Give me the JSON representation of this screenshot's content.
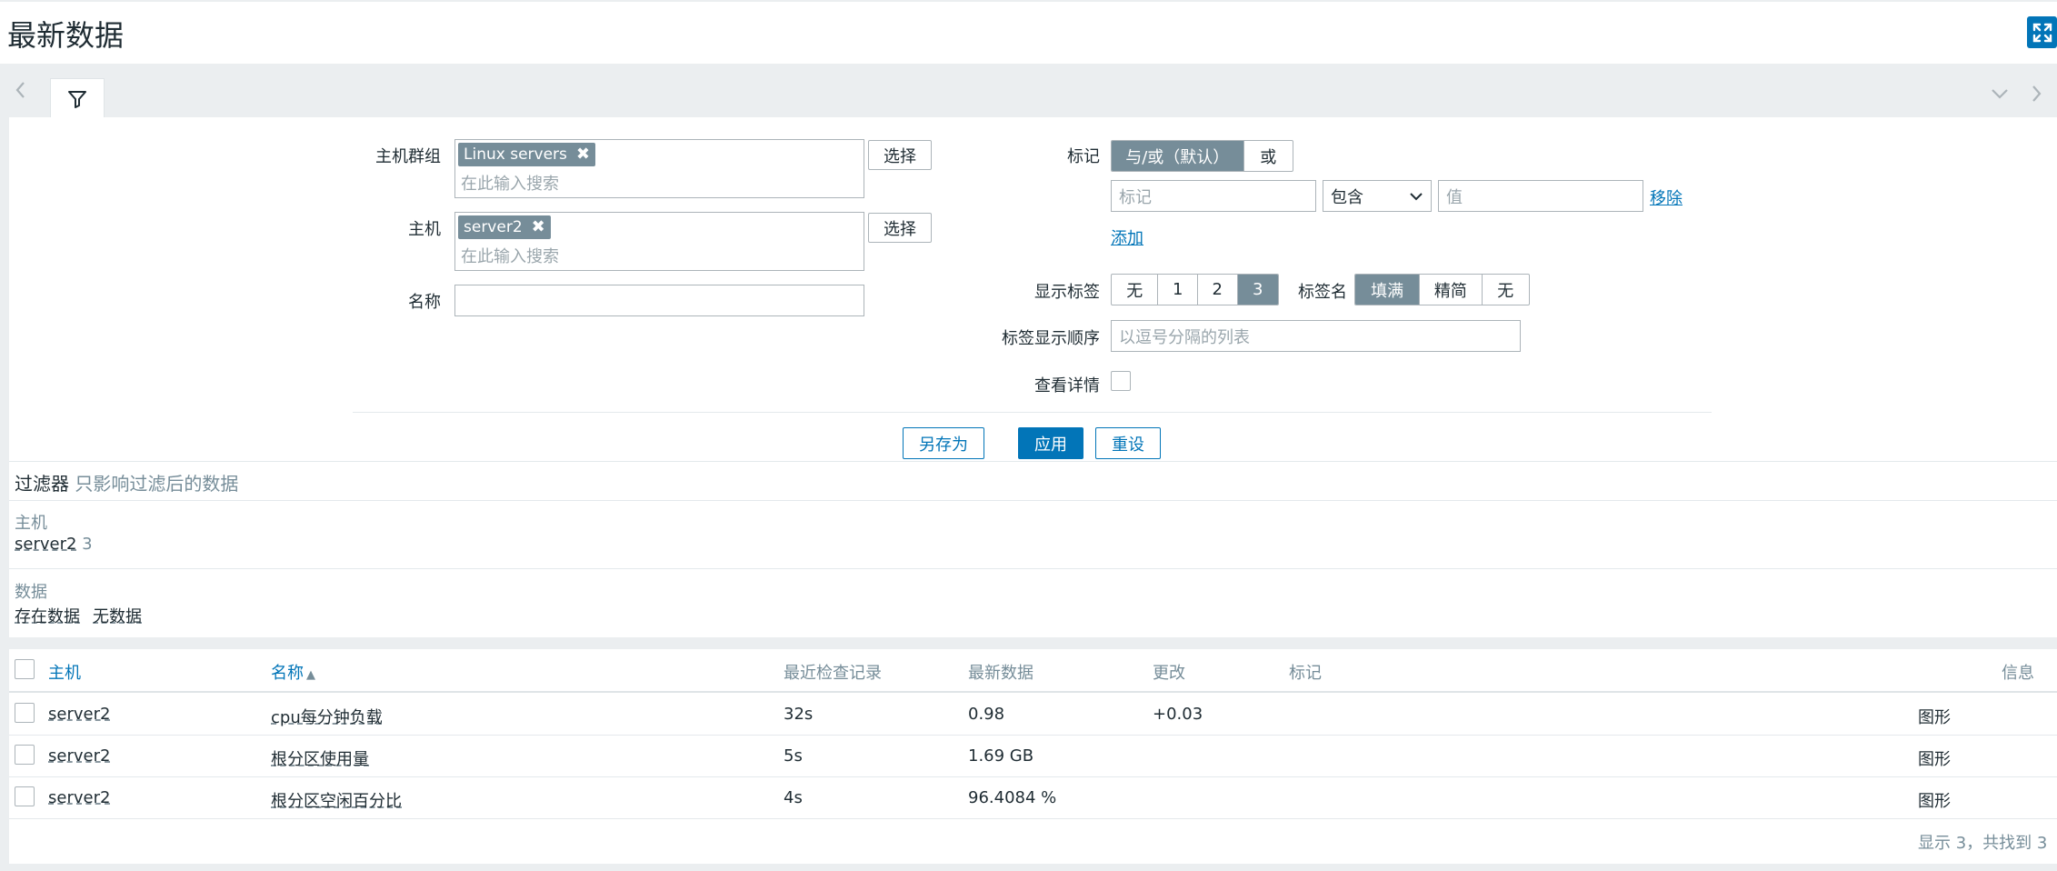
{
  "page": {
    "title": "最新数据"
  },
  "filter": {
    "host_group_label": "主机群组",
    "host_group_chip": "Linux servers",
    "host_label": "主机",
    "host_chip": "server2",
    "search_placeholder": "在此输入搜索",
    "select_label": "选择",
    "name_label": "名称",
    "name_value": "",
    "tags_label": "标记",
    "tag_mode_options": [
      "与/或（默认）",
      "或"
    ],
    "tag_mode_selected": "与/或（默认）",
    "tag_placeholder": "标记",
    "tag_operator": "包含",
    "tag_value_placeholder": "值",
    "remove_label": "移除",
    "add_label": "添加",
    "show_tags_label": "显示标签",
    "show_tags_options": [
      "无",
      "1",
      "2",
      "3"
    ],
    "show_tags_selected": "3",
    "tag_name_label": "标签名",
    "tag_name_options": [
      "填满",
      "精简",
      "无"
    ],
    "tag_name_selected": "填满",
    "tag_order_label": "标签显示顺序",
    "tag_order_placeholder": "以逗号分隔的列表",
    "show_details_label": "查看详情",
    "show_details_checked": false,
    "save_as": "另存为",
    "apply": "应用",
    "reset": "重设"
  },
  "subfilter": {
    "title": "过滤器",
    "hint": "只影响过滤后的数据",
    "host_heading": "主机",
    "host_item": "server2",
    "host_count": "3",
    "data_heading": "数据",
    "data_items": [
      "存在数据",
      "无数据"
    ]
  },
  "table": {
    "columns": {
      "host": "主机",
      "name": "名称",
      "last_check": "最近检查记录",
      "last_value": "最新数据",
      "change": "更改",
      "tags": "标记",
      "info": "信息"
    },
    "sort_indicator": "▲",
    "rows": [
      {
        "host": "server2",
        "name": "cpu每分钟负载",
        "last_check": "32s",
        "last_value": "0.98",
        "change": "+0.03",
        "action": "图形"
      },
      {
        "host": "server2",
        "name": "根分区使用量",
        "last_check": "5s",
        "last_value": "1.69 GB",
        "change": "",
        "action": "图形"
      },
      {
        "host": "server2",
        "name": "根分区空闲百分比",
        "last_check": "4s",
        "last_value": "96.4084 %",
        "change": "",
        "action": "图形"
      }
    ],
    "footer": "显示 3，共找到 3"
  },
  "colors": {
    "accent": "#0275b8",
    "chip": "#768d99",
    "muted": "#768d99"
  },
  "icons": [
    "fullscreen-icon",
    "filter-icon",
    "chevron-left-icon",
    "chevron-down-icon",
    "chevron-right-icon",
    "remove-icon",
    "dropdown-arrow-icon",
    "sort-asc-icon"
  ]
}
